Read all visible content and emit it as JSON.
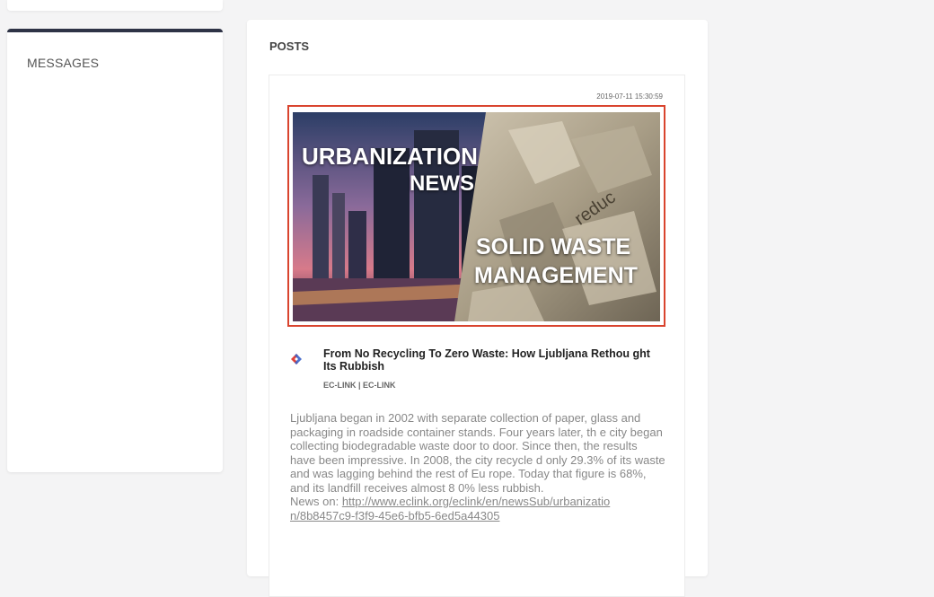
{
  "sidebar": {
    "messages_title": "MESSAGES"
  },
  "posts": {
    "section_title": "POSTS",
    "post": {
      "timestamp": "2019-07-11 15:30:59",
      "image": {
        "line1": "URBANIZATION",
        "line2": "NEWS",
        "line3": "SOLID WASTE",
        "line4": "MANAGEMENT",
        "paper_text": "reduc"
      },
      "title": "From No Recycling To Zero Waste: How Ljubljana Rethou ght Its Rubbish",
      "source": "EC-LINK | EC-LINK",
      "logo_icon": "ec-link-logo-icon",
      "body": "Ljubljana began in 2002 with separate collection of paper, glass and packaging in roadside container stands. Four years later, th e city began collecting biodegradable waste door to door. Since then, the results have been impressive. In 2008, the city recycle d only 29.3% of its waste and was lagging behind the rest of Eu rope. Today that figure is 68%, and its landfill receives almost 8 0% less rubbish.",
      "news_prefix": "News on: ",
      "news_link": "http://www.eclink.org/eclink/en/newsSub/urbanizatio n/8b8457c9-f3f9-45e6-bfb5-6ed5a44305"
    }
  },
  "colors": {
    "accent_border": "#d9442e",
    "panel_top_border": "#2e3346",
    "logo_red": "#e0423a",
    "logo_blue": "#3c63c9"
  }
}
